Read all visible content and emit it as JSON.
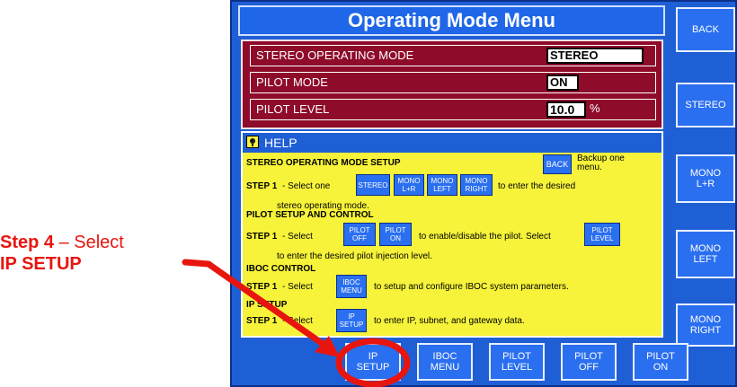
{
  "title": "Operating Mode Menu",
  "side_buttons": [
    {
      "label": "BACK"
    },
    {
      "label": "STEREO"
    },
    {
      "label": "MONO\nL+R"
    },
    {
      "label": "MONO\nLEFT"
    },
    {
      "label": "MONO\nRIGHT"
    }
  ],
  "settings": {
    "stereo_mode": {
      "label": "STEREO OPERATING MODE",
      "value": "STEREO"
    },
    "pilot_mode": {
      "label": "PILOT MODE",
      "value": "ON"
    },
    "pilot_level": {
      "label": "PILOT LEVEL",
      "value": "10.0",
      "unit": "%"
    }
  },
  "help": {
    "header": "HELP",
    "back_button": "BACK",
    "back_text": "Backup one menu.",
    "sections": {
      "stereo_heading": "STEREO OPERATING MODE SETUP",
      "step1": "STEP 1",
      "stereo_step_text": " - Select one",
      "stereo_step_tail": "to enter the desired",
      "stereo_step_tail2": "stereo operating mode.",
      "stereo_buttons": [
        "STEREO",
        "MONO\nL+R",
        "MONO\nLEFT",
        "MONO\nRIGHT"
      ],
      "pilot_heading": "PILOT SETUP AND CONTROL",
      "pilot_step_text": " - Select",
      "pilot_buttons": [
        "PILOT\nOFF",
        "PILOT\nON"
      ],
      "pilot_step_tail": "to enable/disable the pilot.  Select",
      "pilot_level_button": "PILOT\nLEVEL",
      "pilot_step_tail2": "to enter the desired pilot injection level.",
      "iboc_heading": "IBOC CONTROL",
      "iboc_step_text": " - Select",
      "iboc_button": "IBOC\nMENU",
      "iboc_step_tail": "to setup and configure IBOC system parameters.",
      "ip_heading": "IP SETUP",
      "ip_step_text": " - Select",
      "ip_button": "IP\nSETUP",
      "ip_step_tail": "to enter IP, subnet, and gateway data."
    }
  },
  "bottom_buttons": [
    {
      "label": "IP\nSETUP"
    },
    {
      "label": "IBOC\nMENU"
    },
    {
      "label": "PILOT\nLEVEL"
    },
    {
      "label": "PILOT\nOFF"
    },
    {
      "label": "PILOT\nON"
    }
  ],
  "annotation": {
    "step_bold": "Step 4",
    "dash": " – Select",
    "target": "IP SETUP",
    "color": "#e8150f"
  }
}
